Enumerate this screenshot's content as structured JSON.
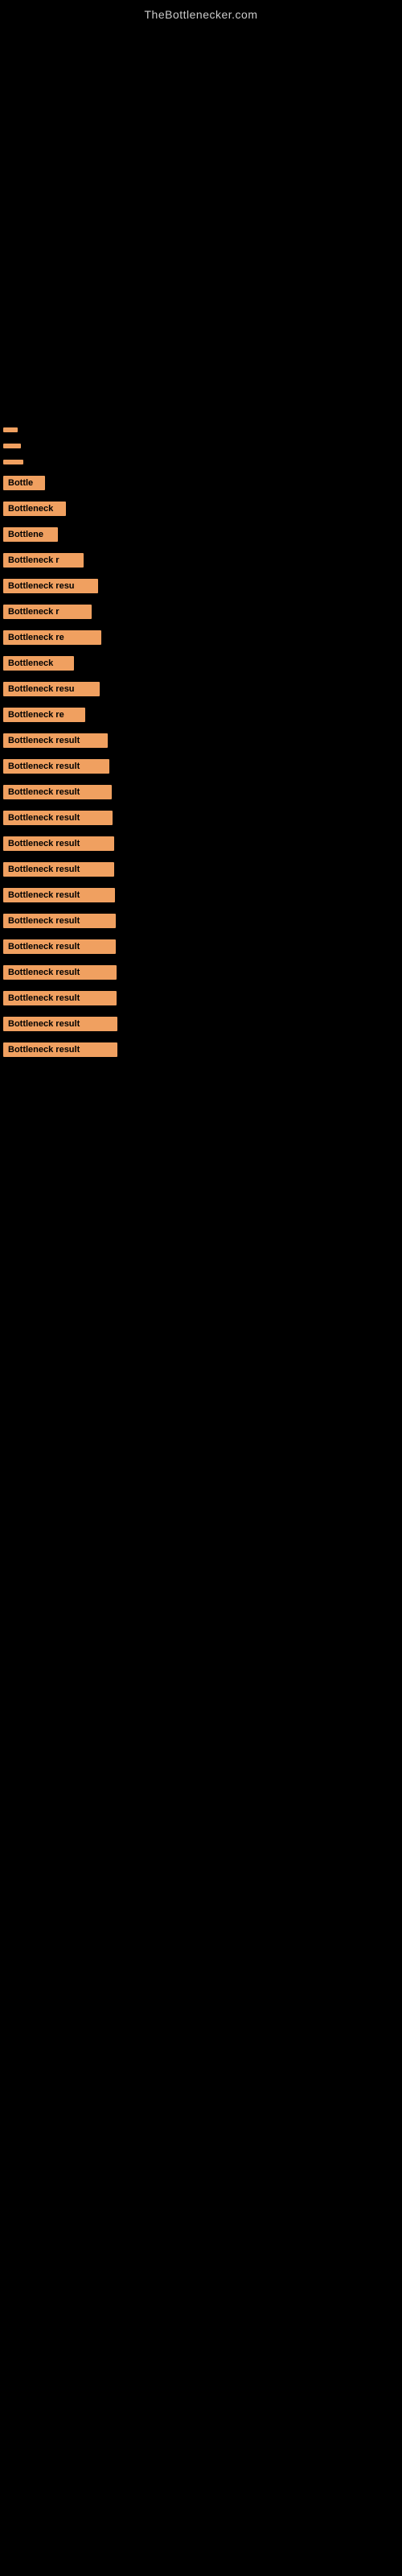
{
  "site": {
    "title": "TheBottlenecker.com"
  },
  "results": [
    {
      "label": "",
      "width_class": "bar-w1"
    },
    {
      "label": "",
      "width_class": "bar-w2"
    },
    {
      "label": "",
      "width_class": "bar-w3"
    },
    {
      "label": "Bottle",
      "width_class": "bar-w4"
    },
    {
      "label": "Bottleneck",
      "width_class": "bar-w5"
    },
    {
      "label": "Bottlene",
      "width_class": "bar-w6"
    },
    {
      "label": "Bottleneck r",
      "width_class": "bar-w7"
    },
    {
      "label": "Bottleneck resu",
      "width_class": "bar-w8"
    },
    {
      "label": "Bottleneck r",
      "width_class": "bar-w9"
    },
    {
      "label": "Bottleneck re",
      "width_class": "bar-w10"
    },
    {
      "label": "Bottleneck",
      "width_class": "bar-w11"
    },
    {
      "label": "Bottleneck resu",
      "width_class": "bar-w12"
    },
    {
      "label": "Bottleneck re",
      "width_class": "bar-w13"
    },
    {
      "label": "Bottleneck result",
      "width_class": "bar-w14"
    },
    {
      "label": "Bottleneck result",
      "width_class": "bar-w15"
    },
    {
      "label": "Bottleneck result",
      "width_class": "bar-w16"
    },
    {
      "label": "Bottleneck result",
      "width_class": "bar-w17"
    },
    {
      "label": "Bottleneck result",
      "width_class": "bar-w18"
    },
    {
      "label": "Bottleneck result",
      "width_class": "bar-w19"
    },
    {
      "label": "Bottleneck result",
      "width_class": "bar-w20"
    },
    {
      "label": "Bottleneck result",
      "width_class": "bar-w21"
    },
    {
      "label": "Bottleneck result",
      "width_class": "bar-w22"
    },
    {
      "label": "Bottleneck result",
      "width_class": "bar-w23"
    },
    {
      "label": "Bottleneck result",
      "width_class": "bar-w24"
    },
    {
      "label": "Bottleneck result",
      "width_class": "bar-w25"
    },
    {
      "label": "Bottleneck result",
      "width_class": "bar-w26"
    }
  ]
}
